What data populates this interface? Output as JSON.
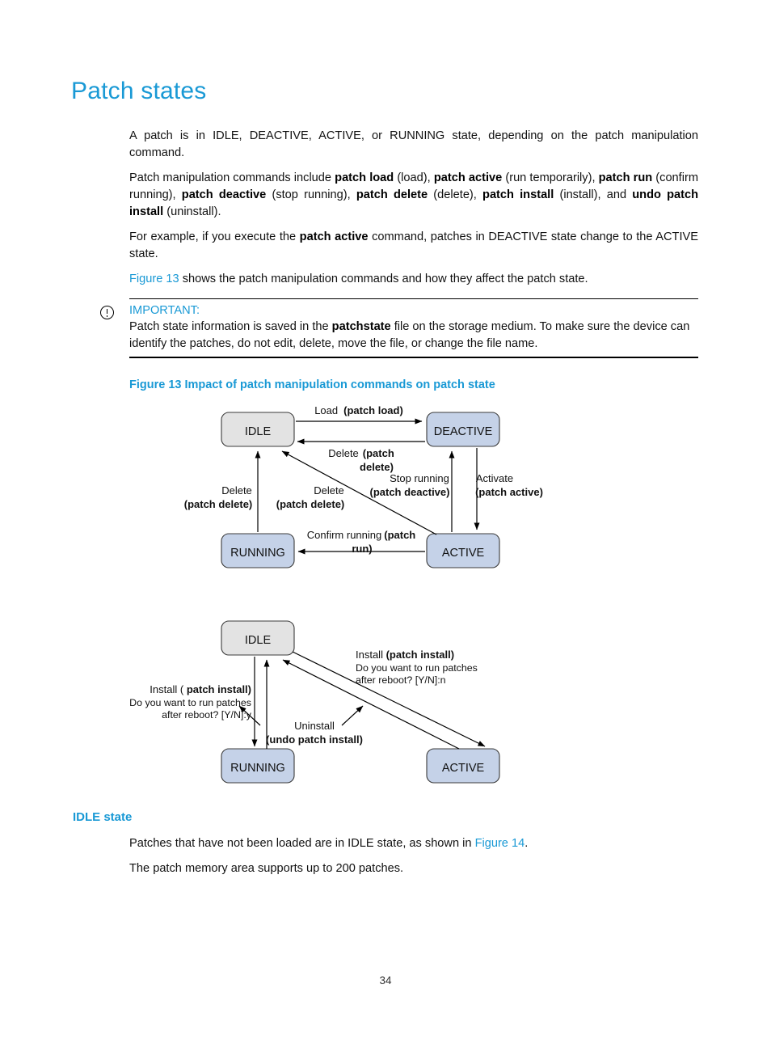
{
  "document": {
    "title": "Patch states",
    "page_number": "34"
  },
  "paragraphs": {
    "intro": "A patch is in IDLE, DEACTIVE, ACTIVE, or RUNNING state, depending on the patch manipulation command.",
    "commands_p1": "Patch manipulation commands include ",
    "example": "For example, if you execute the ",
    "figure_ref_line_suffix": " shows the patch manipulation commands and how they affect the patch state."
  },
  "inline": {
    "patch_load": "patch load",
    "load_paren": " (load), ",
    "patch_active": "patch active",
    "active_paren": " (run temporarily), ",
    "patch_run": "patch run",
    "run_paren": " (confirm running), ",
    "patch_deactive": "patch deactive",
    "deactive_paren": " (stop running), ",
    "patch_delete": "patch delete",
    "delete_paren": " (delete), ",
    "patch_install": "patch install",
    "install_paren": " (install), and ",
    "undo_patch_install": "undo patch install",
    "uninstall_paren": " (uninstall).",
    "example_cmd": "patch active",
    "example_tail": " command, patches in DEACTIVE state change to the ACTIVE state.",
    "figure_13_link": "Figure 13",
    "figure_14_link": "Figure 14",
    "patchstate": "patchstate"
  },
  "note": {
    "label": "IMPORTANT:",
    "icon": "exclamation-circle-icon",
    "text_before_bold": "Patch state information is saved in the ",
    "bold_term": "patchstate",
    "text_after_bold": " file on the storage medium. To make sure the device can identify the patches, do not edit, delete, move the file, or change the file name."
  },
  "figure": {
    "caption": "Figure 13 Impact of patch manipulation commands on patch state"
  },
  "diagram1": {
    "nodes": {
      "idle": "IDLE",
      "deactive": "DEACTIVE",
      "running": "RUNNING",
      "active": "ACTIVE"
    },
    "labels": {
      "load_plain": "Load",
      "load_bold": "(patch load)",
      "delete_top_plain": "Delete",
      "delete_top_bold1": "(patch",
      "delete_top_bold2": "delete)",
      "delete_left_plain": "Delete",
      "delete_left_bold": "(patch delete)",
      "delete_mid_plain": "Delete",
      "delete_mid_bold": "(patch delete)",
      "stop_plain": "Stop running",
      "stop_bold": "(patch deactive)",
      "activate_plain": "Activate",
      "activate_bold": "(patch active)",
      "confirm_plain": "Confirm running",
      "confirm_bold1": "(patch",
      "confirm_bold2": "run)"
    }
  },
  "diagram2": {
    "nodes": {
      "idle": "IDLE",
      "running": "RUNNING",
      "active": "ACTIVE"
    },
    "labels": {
      "install_right_bold_pre": "Install ",
      "install_right_bold": "(patch install)",
      "install_right_line2": "Do you want to run patches",
      "install_right_line3": "after reboot? [Y/N]:n",
      "install_left_plain": "Install (",
      "install_left_bold": " patch install)",
      "install_left_line2": "Do you want to run  patches",
      "install_left_line3": "after  reboot? [Y/N]:y",
      "uninstall_plain": "Uninstall",
      "uninstall_bold": "(undo patch install)"
    }
  },
  "idle_section": {
    "heading": "IDLE state",
    "line1_pre": "Patches that have not been loaded are in IDLE state, as shown in ",
    "line1_link": "Figure 14",
    "line1_post": ".",
    "line2": "The patch memory area supports up to 200 patches."
  },
  "colors": {
    "accent_blue": "#1999d5",
    "node_gray_fill": "#e3e3e3",
    "node_blue_fill": "#c5d2e8",
    "node_stroke": "#3a3a3a",
    "text_black": "#111111"
  }
}
